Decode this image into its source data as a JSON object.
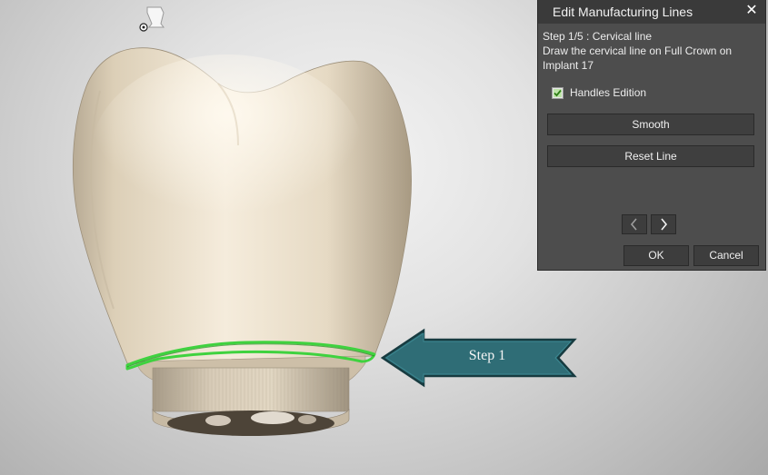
{
  "panel": {
    "title": "Edit Manufacturing Lines",
    "close_icon": "close-icon",
    "step_heading": "Step 1/5 : Cervical line",
    "instruction_line1": "Draw the cervical line on Full Crown on",
    "instruction_line2": "Implant 17",
    "handles_edition": {
      "label": "Handles Edition",
      "checked": true
    },
    "smooth_label": "Smooth",
    "reset_label": "Reset Line",
    "prev_icon": "chevron-left-icon",
    "next_icon": "chevron-right-icon",
    "ok_label": "OK",
    "cancel_label": "Cancel"
  },
  "viewport": {
    "callout_label": "Step 1",
    "callout_color": "#2d6a73",
    "cervical_line_color": "#3fd23f",
    "crown_color": "#e8dcc6",
    "view_cube_icon": "tooth-view-cube-icon"
  }
}
